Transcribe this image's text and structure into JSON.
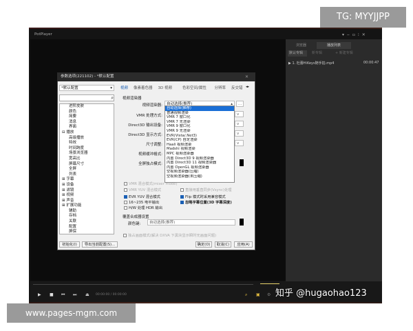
{
  "watermark_top": "TG: MYYJJPP",
  "watermark_bottom": "www.pages-mgm.com",
  "overlay_credit": "知乎 @hugaohao123",
  "player": {
    "title": "PotPlayer",
    "time_current": "00:00:00",
    "time_total": "00:00:00"
  },
  "playlist": {
    "tabs": [
      "浏览器",
      "播放列表"
    ],
    "subtabs": [
      "默认专辑",
      "新专辑",
      "+ 新建专辑"
    ],
    "items": [
      {
        "name": "1. 杜蕾HiKeys随手拍.mp4",
        "duration": "00:00:47"
      }
    ]
  },
  "dialog": {
    "title": "参数选项(221102) - *默认配置",
    "profile": "*默认配置",
    "tree": [
      "进阶皮肤",
      "颜色",
      "简要",
      "消息",
      "界面",
      "⊟ 播放",
      "高级播放",
      "特效",
      "时间跨度",
      "场景浏览器",
      "宽高比",
      "屏幕尺寸",
      "全屏",
      "列表",
      "⊞ 字幕",
      "⊞ 设备",
      "⊞ 滤镜",
      "⊞ 视频",
      "⊞ 声音",
      "⊞ 扩展功能",
      "辅助",
      "存档",
      "关联",
      "配置",
      "屏保"
    ],
    "tabs": [
      "视频",
      "像素着色器",
      "3D 视频",
      "色彩空间/属性",
      "分辨率",
      "反交错",
      "画质"
    ],
    "section_renderer": "视频渲染器",
    "labels": {
      "renderer": "视频渲染器:",
      "vmr_mode": "VMR 处理方式:",
      "d3d_device": "Direct3D 输出设备:",
      "d3d_display": "Direct3D 显示方式:",
      "resize": "尺寸调整:",
      "buffer": "视频缓冲格式:",
      "fullscreen": "全屏独占模式:"
    },
    "renderer_value": "自动选择(推荐)",
    "renderer_options": [
      "自动选择(推荐)",
      "普通视频渲染",
      "VMR 7 窗口化",
      "VMR 7 无渲染",
      "VMR 9 窗口化",
      "VMR 9 无渲染",
      "EVR(Vista/.Net3)",
      "EVR(CP) 自定渲染",
      "Haali 视频渲染",
      "Madshi 视频渲染",
      "MPC 视频渲染器",
      "内置 Direct3D 9 视频渲染器",
      "内置 Direct3D 11 视频渲染器",
      "内置 OpenGL 视频渲染器",
      "空视频渲染器(压缩)",
      "空视频渲染器(未压缩)"
    ],
    "checkboxes": [
      {
        "label": "VMR 混合模式(mixer mode)",
        "checked": false,
        "disabled": true
      },
      {
        "label": "VMR YUV 混合模式",
        "checked": false,
        "disabled": true
      },
      {
        "label": "EVR YUV 混合模式",
        "checked": true,
        "disabled": false
      },
      {
        "label": "16~235 电平输出",
        "checked": false,
        "disabled": false
      },
      {
        "label": "H/W 处理 HDR 输出",
        "checked": false,
        "disabled": false
      },
      {
        "label": "直接用垂直同步(Vsync)处理",
        "checked": false,
        "disabled": true
      },
      {
        "label": "Flip 模式时采用兼容模式",
        "checked": true,
        "disabled": false
      },
      {
        "label": "忽略字幕位置(3D 字幕深度)",
        "checked": true,
        "disabled": false
      }
    ],
    "section_overlay": "覆盖合成器设置",
    "colorkey_label": "颜色键:",
    "colorkey_value": "自动选择(推荐)",
    "exclusive_note": "独占画面模式(解决 DXVA 下黑块显示瞬时无画面问题)",
    "buttons": {
      "init": "初始化(I)",
      "export": "导出当前配置(S)...",
      "ok": "确定(O)",
      "cancel": "取消(C)",
      "apply": "应用(A)"
    }
  }
}
